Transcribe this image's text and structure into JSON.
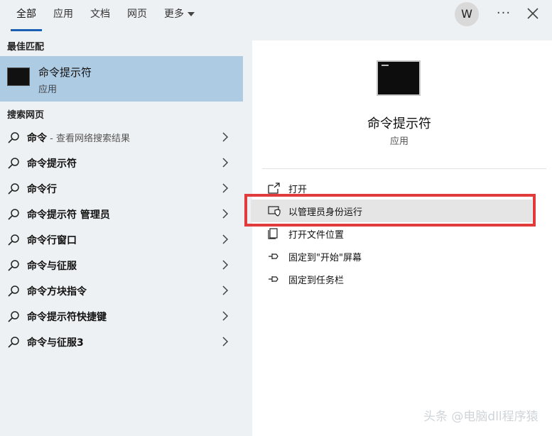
{
  "tabs": [
    {
      "label": "全部",
      "active": true
    },
    {
      "label": "应用"
    },
    {
      "label": "文档"
    },
    {
      "label": "网页"
    },
    {
      "label": "更多"
    }
  ],
  "user": {
    "avatar_letter": "W"
  },
  "header_icons": [
    "more-options-icon",
    "close-icon"
  ],
  "best_match": {
    "section_title": "最佳匹配",
    "name": "命令提示符",
    "type": "应用"
  },
  "web_search": {
    "section_title": "搜索网页",
    "items": [
      {
        "label": "命令",
        "suffix": " - 查看网络搜索结果"
      },
      {
        "label": "命令提示符"
      },
      {
        "label": "命令行"
      },
      {
        "label": "命令提示符 管理员"
      },
      {
        "label": "命令行窗口"
      },
      {
        "label": "命令与征服"
      },
      {
        "label": "命令方块指令"
      },
      {
        "label": "命令提示符快捷键"
      },
      {
        "label": "命令与征服3"
      }
    ]
  },
  "detail": {
    "title": "命令提示符",
    "subtitle": "应用",
    "actions": [
      {
        "label": "打开",
        "icon": "open-icon"
      },
      {
        "label": "以管理员身份运行",
        "icon": "shield-icon",
        "highlighted": true
      },
      {
        "label": "打开文件位置",
        "icon": "file-location-icon"
      },
      {
        "label": "固定到\"开始\"屏幕",
        "icon": "pin-icon"
      },
      {
        "label": "固定到任务栏",
        "icon": "pin-icon"
      }
    ]
  },
  "watermark": "头条 @电脑dll程序猿",
  "colors": {
    "accent": "#1a5fb4",
    "selected_bg": "#aecbe4",
    "annotation_red": "#e23b3b"
  }
}
